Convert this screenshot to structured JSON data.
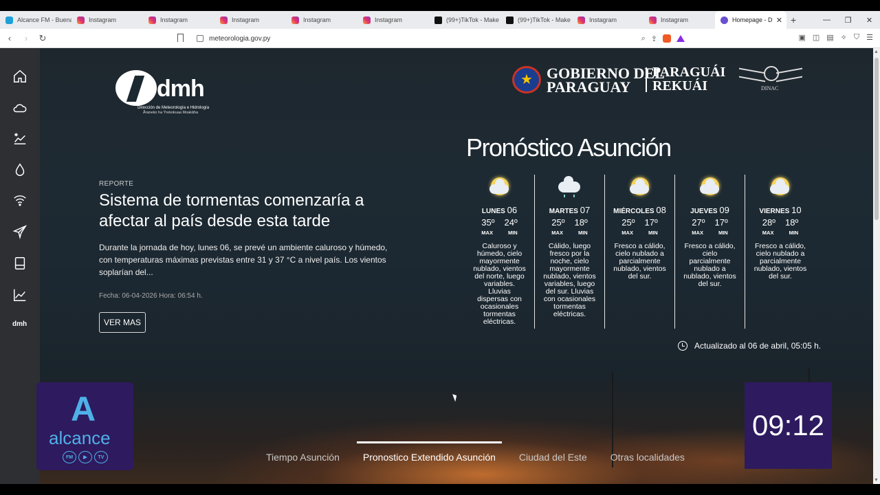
{
  "browser": {
    "tabs": [
      {
        "label": "Alcance FM - Buena",
        "icon": "alcance-icon",
        "active": false
      },
      {
        "label": "Instagram",
        "icon": "instagram-icon",
        "active": false
      },
      {
        "label": "Instagram",
        "icon": "instagram-icon",
        "active": false
      },
      {
        "label": "Instagram",
        "icon": "instagram-icon",
        "active": false
      },
      {
        "label": "Instagram",
        "icon": "instagram-icon",
        "active": false
      },
      {
        "label": "Instagram",
        "icon": "instagram-icon",
        "active": false
      },
      {
        "label": "(99+)TikTok - Make",
        "icon": "tiktok-icon",
        "active": false
      },
      {
        "label": "(99+)TikTok - Make",
        "icon": "tiktok-icon",
        "active": false
      },
      {
        "label": "Instagram",
        "icon": "instagram-icon",
        "active": false
      },
      {
        "label": "Instagram",
        "icon": "instagram-icon",
        "active": false
      },
      {
        "label": "Homepage - D",
        "icon": "dmh-site-icon",
        "active": true
      }
    ],
    "new_tab": "+",
    "window_controls": {
      "minimize": "—",
      "restore": "❐",
      "close": "✕"
    },
    "url": "meteorologia.gov.py"
  },
  "sidebar": {
    "items": [
      "home-icon",
      "cloud-icon",
      "snow-chart-icon",
      "drop-icon",
      "wifi-icon",
      "plane-icon",
      "device-icon",
      "line-chart-icon"
    ],
    "brand": "dmh"
  },
  "logo": {
    "word": "dmh",
    "line1": "Dirección de Meteorología e Hidrología",
    "line2": "Ãraneko ha Ýrekokuaa Moakãha"
  },
  "government": {
    "line1": "GOBIERNO DEL",
    "line2": "PARAGUAY",
    "line3": "PARAGUÁI",
    "line4": "REKUÁI",
    "agency": "DINAC"
  },
  "news": {
    "kicker": "REPORTE",
    "headline": "Sistema de tormentas comenzaría a afectar al país desde esta tarde",
    "summary": "Durante la jornada de hoy, lunes 06, se prevé un ambiente caluroso y húmedo, con temperaturas máximas previstas entre 31 y 37 °C a nivel país. Los vientos soplarían del...",
    "date": "Fecha: 06-04-2026 Hora: 06:54 h.",
    "button": "VER MAS"
  },
  "forecast": {
    "title": "Pronóstico Asunción",
    "max_label": "MAX",
    "min_label": "MIN",
    "days": [
      {
        "name": "LUNES",
        "num": "06",
        "max": "35º",
        "min": "24º",
        "icon": "sun-cloud-icon",
        "desc": "Caluroso y húmedo, cielo mayormente nublado, vientos del norte, luego variables. Lluvias dispersas con ocasionales tormentas eléctricas."
      },
      {
        "name": "MARTES",
        "num": "07",
        "max": "25º",
        "min": "18º",
        "icon": "rain-cloud-icon",
        "desc": "Cálido, luego fresco por la noche, cielo mayormente nublado, vientos variables, luego del sur. Lluvias con ocasionales tormentas eléctricas."
      },
      {
        "name": "MIÉRCOLES",
        "num": "08",
        "max": "25º",
        "min": "17º",
        "icon": "sun-cloud-icon",
        "desc": "Fresco a cálido, cielo nublado a parcialmente nublado, vientos del sur."
      },
      {
        "name": "JUEVES",
        "num": "09",
        "max": "27º",
        "min": "17º",
        "icon": "sun-cloud-icon",
        "desc": "Fresco a cálido, cielo parcialmente nublado a nublado, vientos del sur."
      },
      {
        "name": "VIERNES",
        "num": "10",
        "max": "28º",
        "min": "18º",
        "icon": "sun-cloud-icon",
        "desc": "Fresco a cálido, cielo nublado a parcialmente nublado, vientos del sur."
      }
    ],
    "updated": "Actualizado al 06 de abril, 05:05 h."
  },
  "overlay": {
    "brand_letter": "A",
    "brand": "alcance",
    "subs": [
      "FM",
      "▶",
      "TV"
    ],
    "clock": "09:12"
  },
  "bottom_tabs": [
    {
      "label": "Tiempo Asunción",
      "active": false
    },
    {
      "label": "Pronostico Extendido Asunción",
      "active": true
    },
    {
      "label": "Ciudad del Este",
      "active": false
    },
    {
      "label": "Otras localidades",
      "active": false
    }
  ],
  "colors": {
    "accent_purple": "#2e1a5e",
    "alcance_blue": "#4fb0e8",
    "sidebar": "#2d2f33"
  }
}
